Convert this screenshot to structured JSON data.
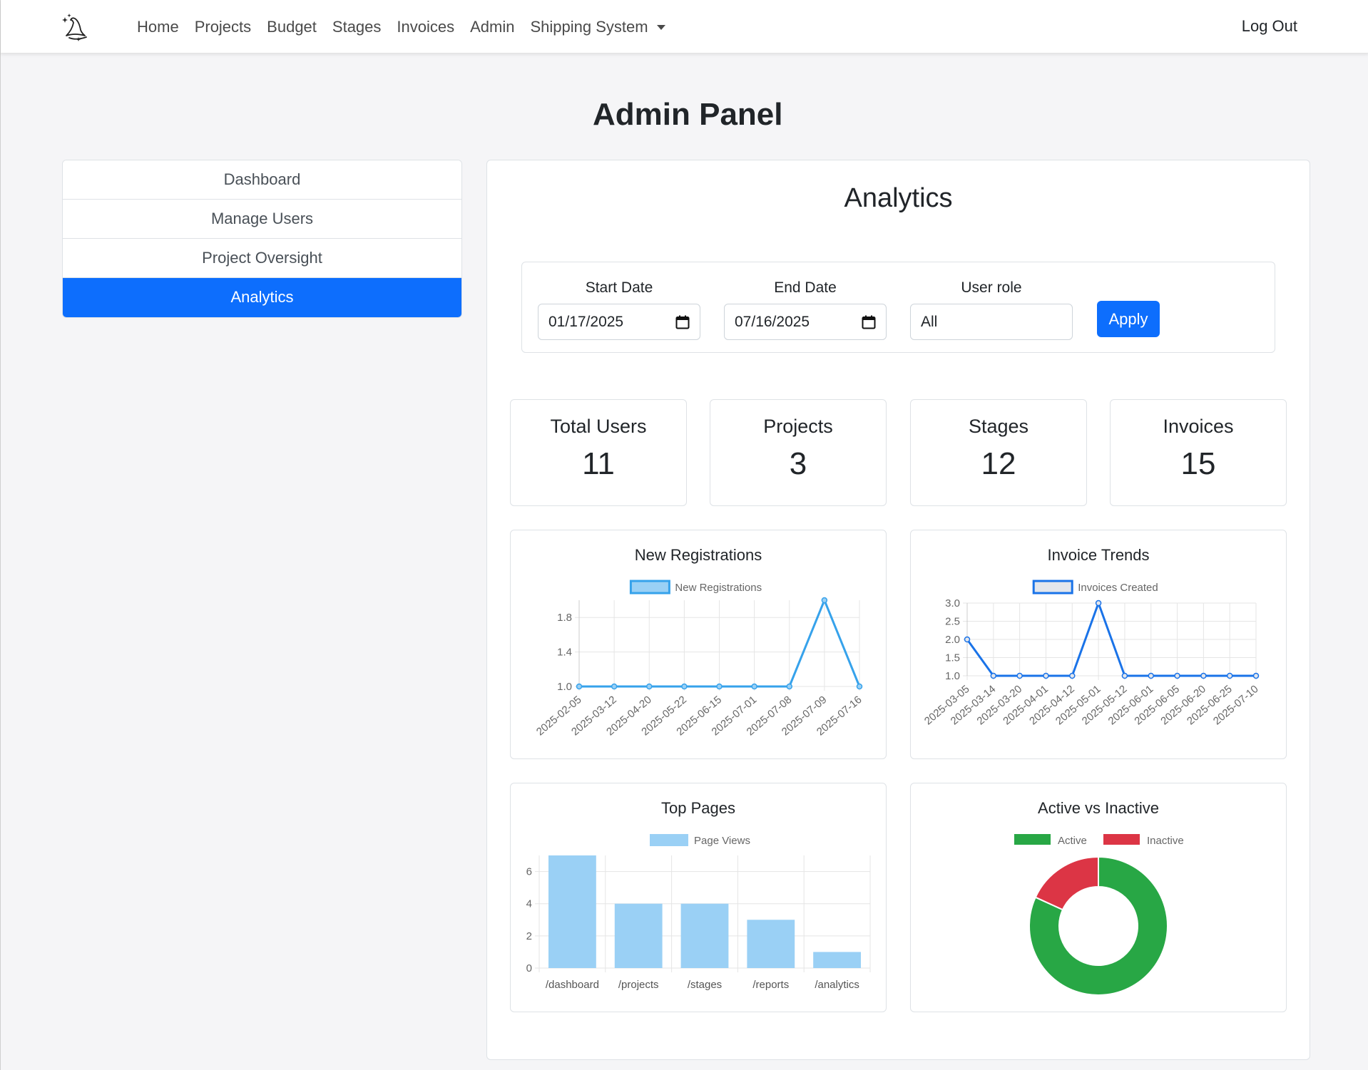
{
  "nav": {
    "logo_icon": "wizard-hat-icon",
    "links": [
      "Home",
      "Projects",
      "Budget",
      "Stages",
      "Invoices",
      "Admin",
      "Shipping System"
    ],
    "logout": "Log Out"
  },
  "page_title": "Admin Panel",
  "sidebar": {
    "items": [
      {
        "label": "Dashboard",
        "active": false
      },
      {
        "label": "Manage Users",
        "active": false
      },
      {
        "label": "Project Oversight",
        "active": false
      },
      {
        "label": "Analytics",
        "active": true
      }
    ]
  },
  "analytics": {
    "title": "Analytics",
    "filters": {
      "start_label": "Start Date",
      "start_value": "01/17/2025",
      "end_label": "End Date",
      "end_value": "07/16/2025",
      "role_label": "User role",
      "role_value": "All",
      "apply_label": "Apply"
    },
    "stats": [
      {
        "label": "Total Users",
        "value": "11"
      },
      {
        "label": "Projects",
        "value": "3"
      },
      {
        "label": "Stages",
        "value": "12"
      },
      {
        "label": "Invoices",
        "value": "15"
      }
    ],
    "colors": {
      "primary": "#0d6efd",
      "registrations": "#36a2eb",
      "invoices": "#1a73e8",
      "pages": "#9ad0f5",
      "active": "#28a745",
      "inactive": "#dc3545"
    }
  },
  "chart_data": [
    {
      "type": "line",
      "title": "New Registrations",
      "x": [
        "2025-02-05",
        "2025-03-12",
        "2025-04-20",
        "2025-05-22",
        "2025-06-15",
        "2025-07-01",
        "2025-07-08",
        "2025-07-09",
        "2025-07-16"
      ],
      "series": [
        {
          "name": "New Registrations",
          "values": [
            1,
            1,
            1,
            1,
            1,
            1,
            1,
            2,
            1
          ]
        }
      ],
      "ylim": [
        1.0,
        2.0
      ],
      "yticks": [
        "1.0",
        "1.4",
        "1.8"
      ],
      "grid": true,
      "legend": "top"
    },
    {
      "type": "line",
      "title": "Invoice Trends",
      "x": [
        "2025-03-05",
        "2025-03-14",
        "2025-03-20",
        "2025-04-01",
        "2025-04-12",
        "2025-05-01",
        "2025-05-12",
        "2025-06-01",
        "2025-06-05",
        "2025-06-20",
        "2025-06-25",
        "2025-07-10"
      ],
      "series": [
        {
          "name": "Invoices Created",
          "values": [
            2,
            1,
            1,
            1,
            1,
            3,
            1,
            1,
            1,
            1,
            1,
            1
          ]
        }
      ],
      "ylim": [
        1.0,
        3.0
      ],
      "yticks": [
        "1.0",
        "1.5",
        "2.0",
        "2.5",
        "3.0"
      ],
      "grid": true,
      "legend": "top"
    },
    {
      "type": "bar",
      "title": "Top Pages",
      "categories": [
        "/dashboard",
        "/projects",
        "/stages",
        "/reports",
        "/analytics"
      ],
      "series": [
        {
          "name": "Page Views",
          "values": [
            7,
            4,
            4,
            3,
            1
          ]
        }
      ],
      "ylim": [
        0,
        7
      ],
      "yticks": [
        "0",
        "2",
        "4",
        "6"
      ],
      "grid": true,
      "legend": "top"
    },
    {
      "type": "pie",
      "title": "Active vs Inactive",
      "categories": [
        "Active",
        "Inactive"
      ],
      "values": [
        9,
        2
      ],
      "legend": "top"
    }
  ]
}
